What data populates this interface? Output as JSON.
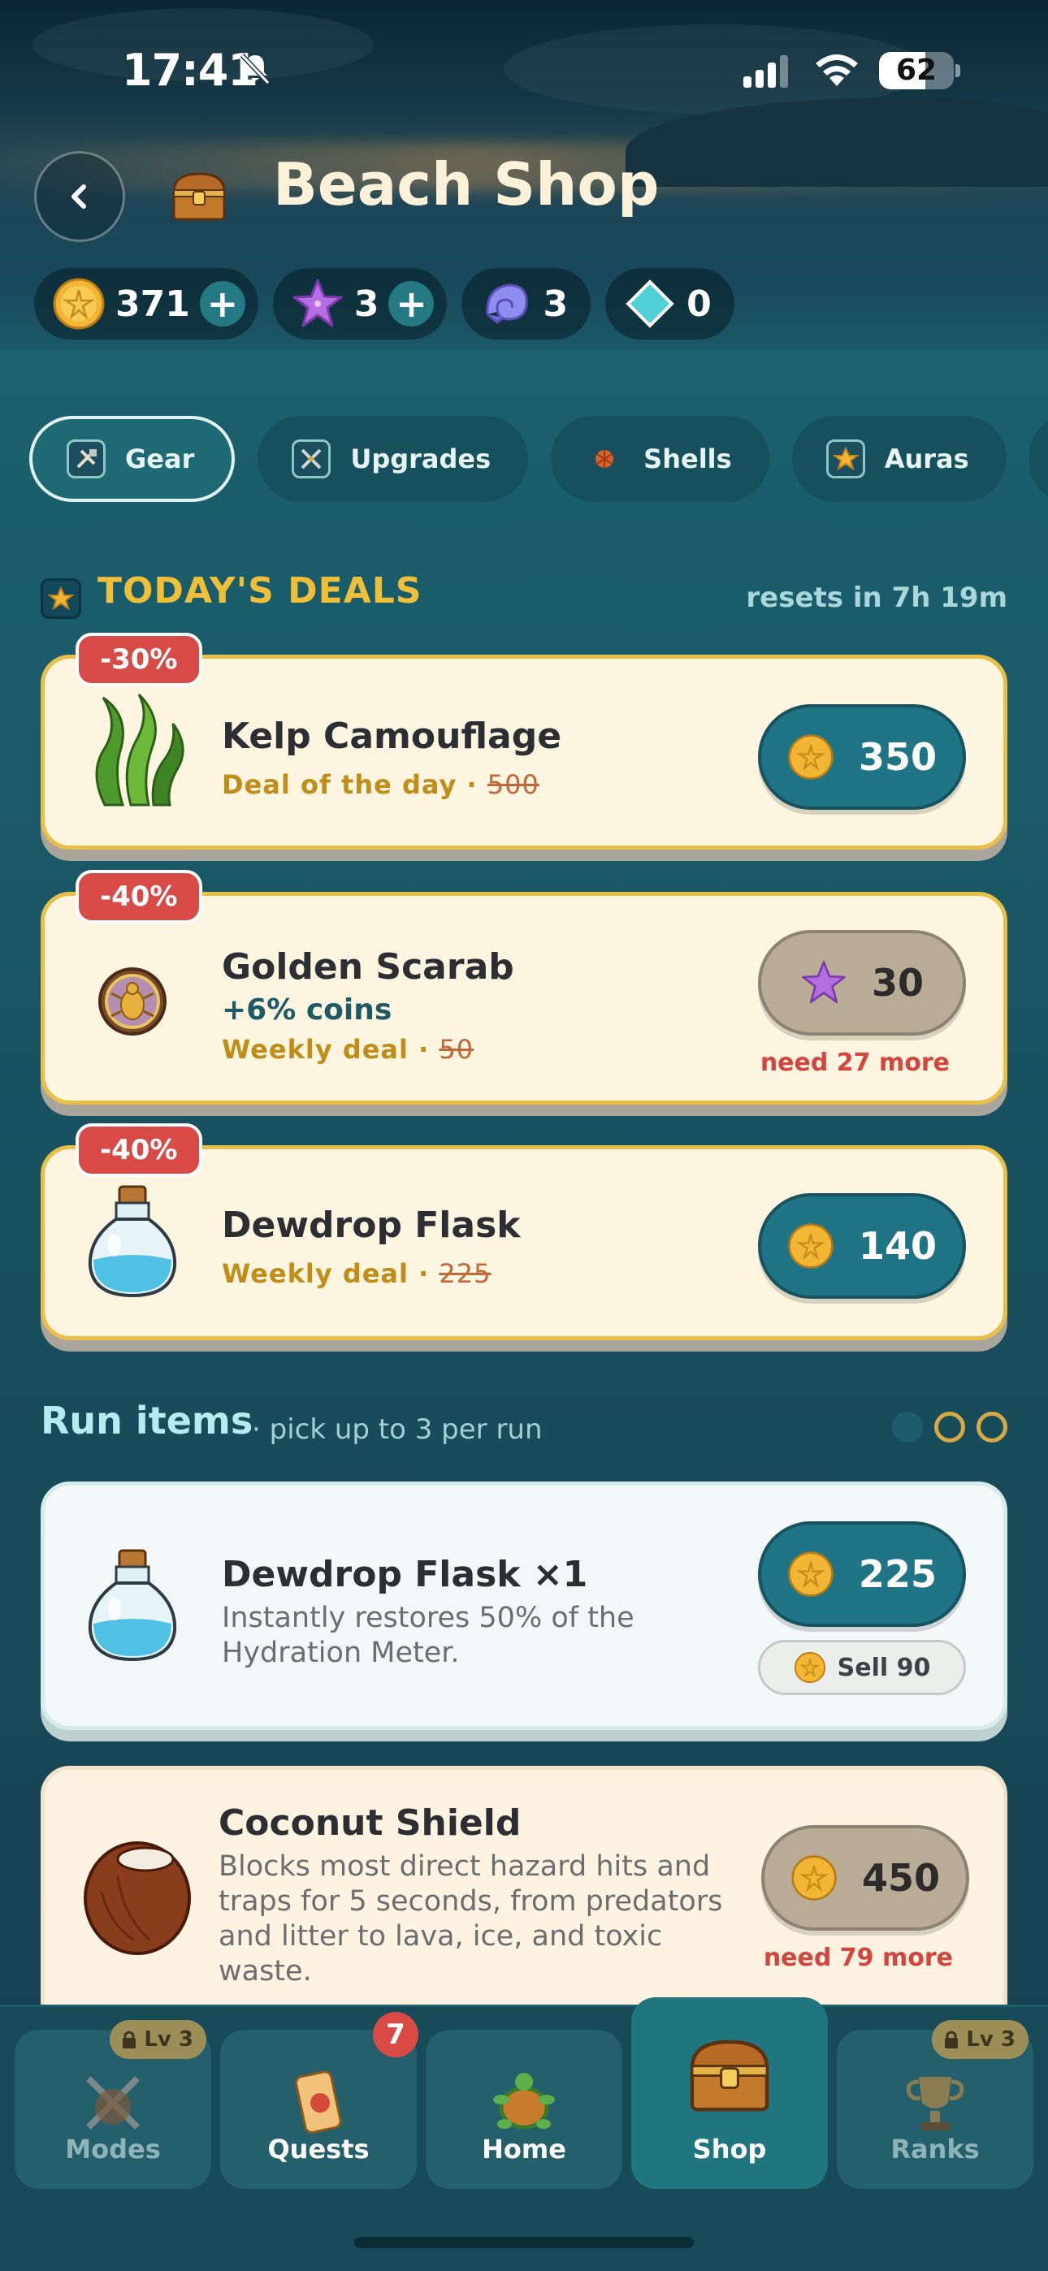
{
  "status_bar": {
    "time": "17:41",
    "battery": "62",
    "battery_level": 0.62
  },
  "header": {
    "title": "Beach Shop",
    "back_icon": "chevron-left-icon",
    "title_icon": "treasure-chest-icon"
  },
  "currencies": [
    {
      "icon": "sand-dollar-coin-icon",
      "value": "371",
      "has_plus": true
    },
    {
      "icon": "starfish-icon",
      "value": "3",
      "has_plus": true
    },
    {
      "icon": "seashell-icon",
      "value": "3",
      "has_plus": false
    },
    {
      "icon": "diamond-gem-icon",
      "value": "0",
      "has_plus": false
    }
  ],
  "tabs": [
    {
      "label": "Gear",
      "icon": "tools-icon",
      "active": true
    },
    {
      "label": "Upgrades",
      "icon": "crossed-swords-icon",
      "active": false
    },
    {
      "label": "Shells",
      "icon": "shell-icon",
      "active": false
    },
    {
      "label": "Auras",
      "icon": "star-aura-icon",
      "active": false
    }
  ],
  "deals": {
    "title": "TODAY'S DEALS",
    "resets": "resets in 7h 19m",
    "items": [
      {
        "discount": "-30%",
        "name": "Kelp Camouflage",
        "bonus": "",
        "tag": "Deal of the day",
        "old_price": "500",
        "price": "350",
        "currency": "coin",
        "need": ""
      },
      {
        "discount": "-40%",
        "name": "Golden Scarab",
        "bonus": "+6% coins",
        "tag": "Weekly deal",
        "old_price": "50",
        "price": "30",
        "currency": "starfish",
        "need": "need 27 more"
      },
      {
        "discount": "-40%",
        "name": "Dewdrop Flask",
        "bonus": "",
        "tag": "Weekly deal",
        "old_price": "225",
        "price": "140",
        "currency": "coin",
        "need": ""
      }
    ]
  },
  "run_items": {
    "title": "Run items",
    "hint": "· pick up to 3 per run",
    "page": 1,
    "pages": 3,
    "items": [
      {
        "name": "Dewdrop Flask ×1",
        "desc": "Instantly restores 50% of the Hydration Meter.",
        "price": "225",
        "sell": "Sell 90",
        "need": ""
      },
      {
        "name": "Coconut Shield",
        "desc": "Blocks most direct hazard hits and traps for 5 seconds, from predators and litter to lava, ice, and toxic waste.",
        "price": "450",
        "sell": "",
        "need": "need 79 more"
      }
    ]
  },
  "nav": [
    {
      "label": "Modes",
      "icon": "modes-icon",
      "lock": "Lv 3",
      "badge": "",
      "active": false
    },
    {
      "label": "Quests",
      "icon": "scroll-icon",
      "lock": "",
      "badge": "7",
      "active": false
    },
    {
      "label": "Home",
      "icon": "turtle-icon",
      "lock": "",
      "badge": "",
      "active": false
    },
    {
      "label": "Shop",
      "icon": "treasure-chest-icon",
      "lock": "",
      "badge": "",
      "active": true
    },
    {
      "label": "Ranks",
      "icon": "trophy-icon",
      "lock": "Lv 3",
      "badge": "",
      "active": false
    }
  ],
  "colors": {
    "accent_gold": "#f0bf3a",
    "teal_button": "#1f7585",
    "discount_red": "#d84a45",
    "need_red": "#d4453f"
  }
}
